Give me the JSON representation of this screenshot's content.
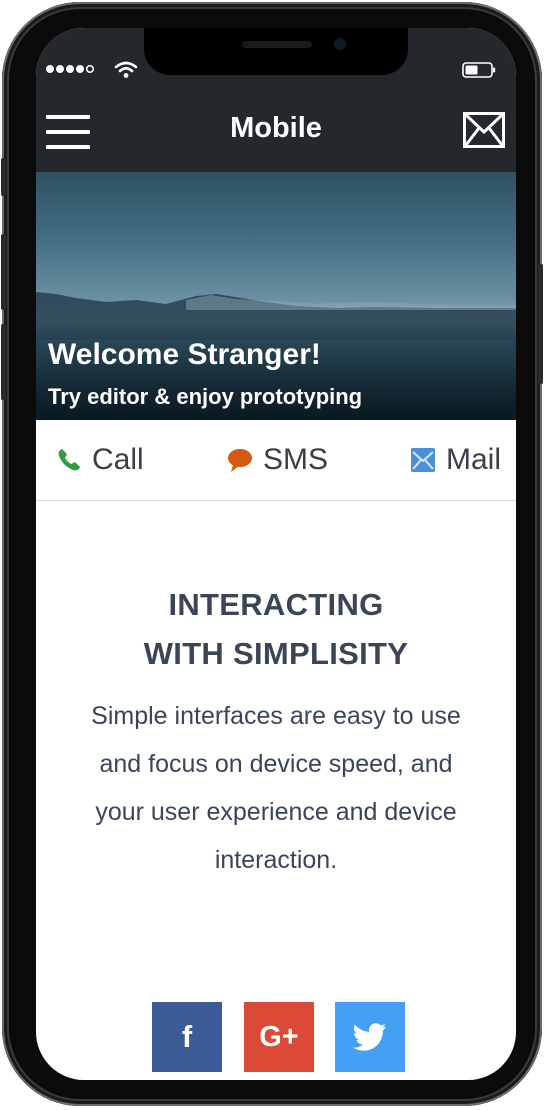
{
  "status_bar": {
    "signal_icon": "signal-dots-icon",
    "wifi_icon": "wifi-icon",
    "battery_icon": "battery-icon"
  },
  "header": {
    "title": "Mobile",
    "menu_icon": "hamburger-menu-icon",
    "action_icon": "envelope-icon"
  },
  "hero": {
    "title": "Welcome Stranger!",
    "subtitle": "Try editor & enjoy prototyping"
  },
  "contact": [
    {
      "label": "Call",
      "icon": "phone-icon",
      "color": "#2e9d45"
    },
    {
      "label": "SMS",
      "icon": "speech-bubble-icon",
      "color": "#d45a11"
    },
    {
      "label": "Mail",
      "icon": "mail-icon",
      "color": "#4a90d9"
    }
  ],
  "content": {
    "heading_line1": "INTERACTING",
    "heading_line2": "WITH SIMPLISITY",
    "body": "Simple interfaces are easy to use and focus on device speed, and your user experience and device interaction."
  },
  "social": [
    {
      "label": "f",
      "icon": "facebook-icon",
      "color": "#3b5a98"
    },
    {
      "label": "G+",
      "icon": "google-plus-icon",
      "color": "#da4a37"
    },
    {
      "label": "",
      "icon": "twitter-bird-icon",
      "color": "#44a0f2"
    }
  ]
}
